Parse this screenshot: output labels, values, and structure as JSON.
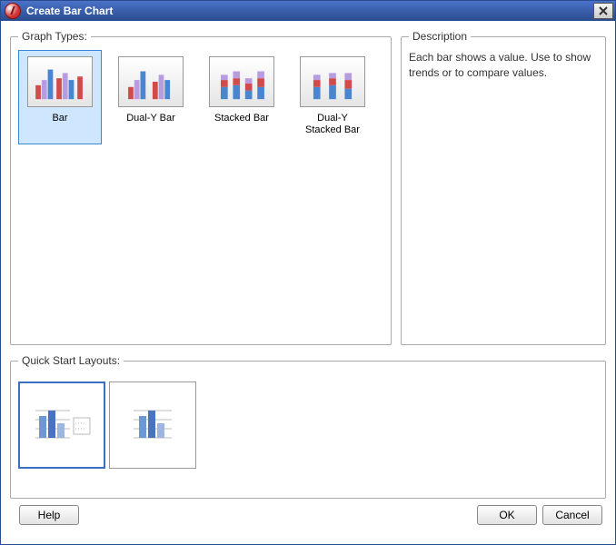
{
  "window": {
    "title": "Create  Bar Chart"
  },
  "sections": {
    "graphTypesLabel": "Graph Types:",
    "descriptionLabel": "Description",
    "quickStartLabel": "Quick Start Layouts:"
  },
  "graphTypes": {
    "items": [
      {
        "label": "Bar"
      },
      {
        "label": "Dual-Y Bar"
      },
      {
        "label": "Stacked Bar"
      },
      {
        "label": "Dual-Y\nStacked Bar"
      }
    ]
  },
  "description": {
    "text": "Each bar shows a value. Use to show trends or to compare values."
  },
  "buttons": {
    "help": "Help",
    "ok": "OK",
    "cancel": "Cancel"
  }
}
